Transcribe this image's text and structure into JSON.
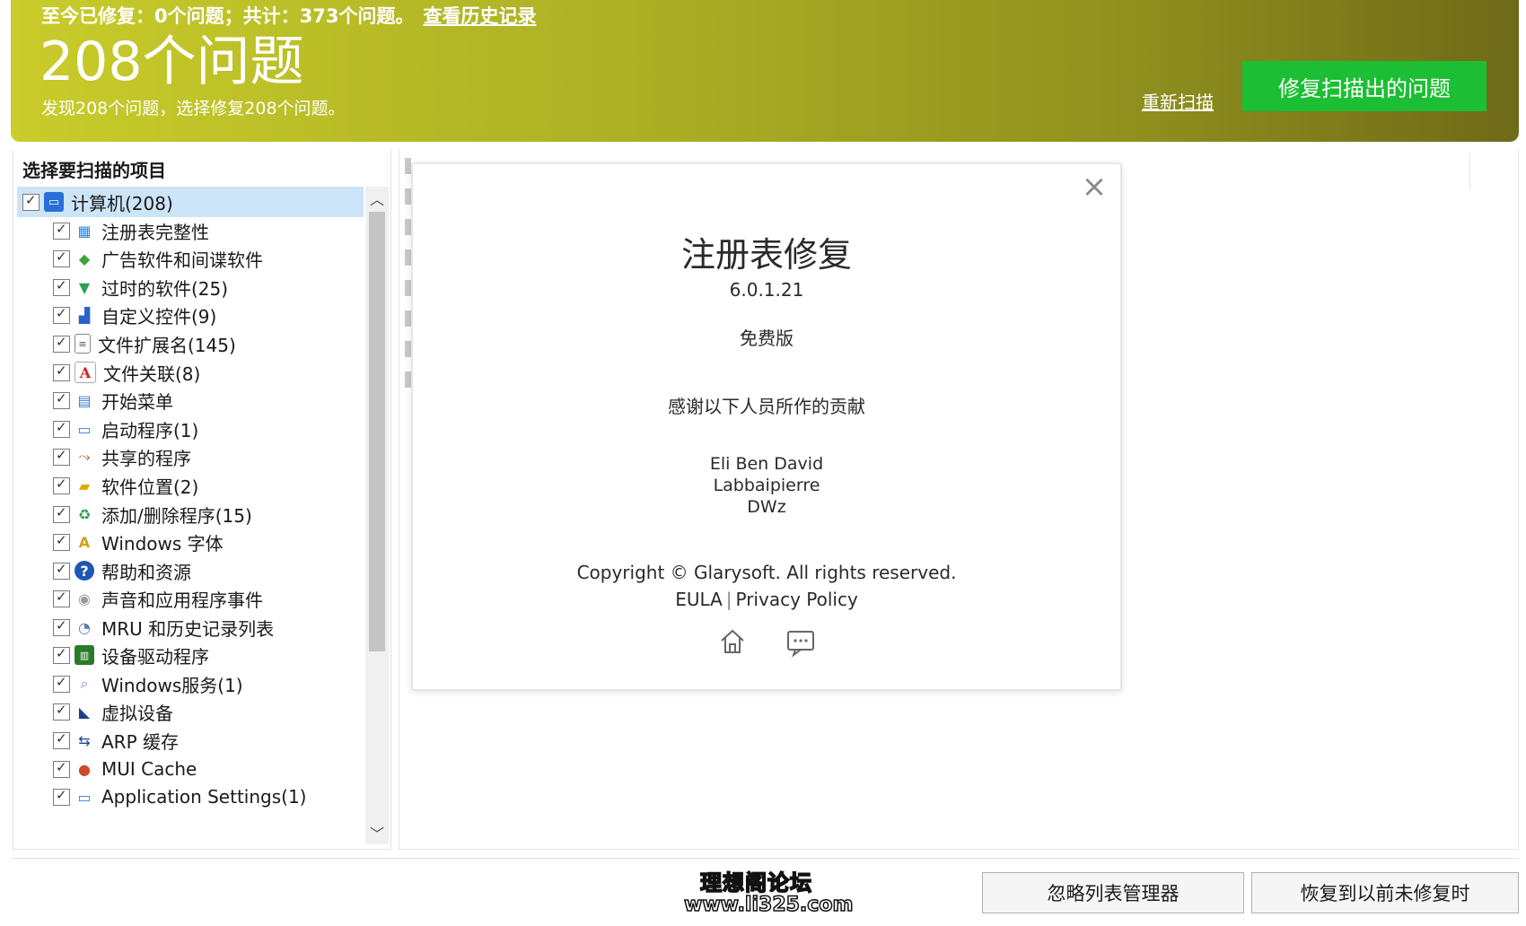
{
  "banner": {
    "summary_prefix": "至今已修复：0个问题；共计：373个问题。",
    "history_link": "查看历史记录",
    "big_title": "208个问题",
    "description": "发现208个问题，选择修复208个问题。",
    "rescan_link": "重新扫描",
    "fix_button": "修复扫描出的问题",
    "fix_button_color": "#1cbf33"
  },
  "left_panel": {
    "title": "选择要扫描的项目",
    "root": {
      "label": "计算机(208)",
      "checked": true,
      "icon": "computer-icon"
    },
    "items": [
      {
        "label": "注册表完整性",
        "checked": true,
        "icon": "registry-icon"
      },
      {
        "label": "广告软件和间谍软件",
        "checked": true,
        "icon": "shield-icon"
      },
      {
        "label": "过时的软件(25)",
        "checked": true,
        "icon": "trash-icon"
      },
      {
        "label": "自定义控件(9)",
        "checked": true,
        "icon": "blocks-icon"
      },
      {
        "label": "文件扩展名(145)",
        "checked": true,
        "icon": "file-icon"
      },
      {
        "label": "文件关联(8)",
        "checked": true,
        "icon": "font-a-icon"
      },
      {
        "label": "开始菜单",
        "checked": true,
        "icon": "start-menu-icon"
      },
      {
        "label": "启动程序(1)",
        "checked": true,
        "icon": "window-icon"
      },
      {
        "label": "共享的程序",
        "checked": true,
        "icon": "share-icon"
      },
      {
        "label": "软件位置(2)",
        "checked": true,
        "icon": "folder-icon"
      },
      {
        "label": "添加/删除程序(15)",
        "checked": true,
        "icon": "recycle-icon"
      },
      {
        "label": "Windows 字体",
        "checked": true,
        "icon": "fonts-icon"
      },
      {
        "label": "帮助和资源",
        "checked": true,
        "icon": "help-icon"
      },
      {
        "label": "声音和应用程序事件",
        "checked": true,
        "icon": "sound-icon"
      },
      {
        "label": "MRU 和历史记录列表",
        "checked": true,
        "icon": "history-icon"
      },
      {
        "label": "设备驱动程序",
        "checked": true,
        "icon": "device-icon"
      },
      {
        "label": "Windows服务(1)",
        "checked": true,
        "icon": "services-icon"
      },
      {
        "label": "虚拟设备",
        "checked": true,
        "icon": "virtual-device-icon"
      },
      {
        "label": "ARP 缓存",
        "checked": true,
        "icon": "network-icon"
      },
      {
        "label": "MUI Cache",
        "checked": true,
        "icon": "cache-icon"
      },
      {
        "label": "Application Settings(1)",
        "checked": true,
        "icon": "settings-icon"
      }
    ]
  },
  "about_dialog": {
    "title": "注册表修复",
    "version": "6.0.1.21",
    "edition": "免费版",
    "thanks_heading": "感谢以下人员所作的贡献",
    "contributors": [
      "Eli Ben David",
      "Labbaipierre",
      "DWz"
    ],
    "copyright": "Copyright © Glarysoft. All rights reserved.",
    "eula_link": "EULA",
    "privacy_link": "Privacy Policy",
    "link_separator": "|",
    "icons": [
      "home-icon",
      "feedback-icon"
    ]
  },
  "watermark": {
    "line1": "理想阁论坛",
    "line2": "www.li325.com"
  },
  "bottom": {
    "ignore_list_button": "忽略列表管理器",
    "restore_button": "恢复到以前未修复时"
  }
}
